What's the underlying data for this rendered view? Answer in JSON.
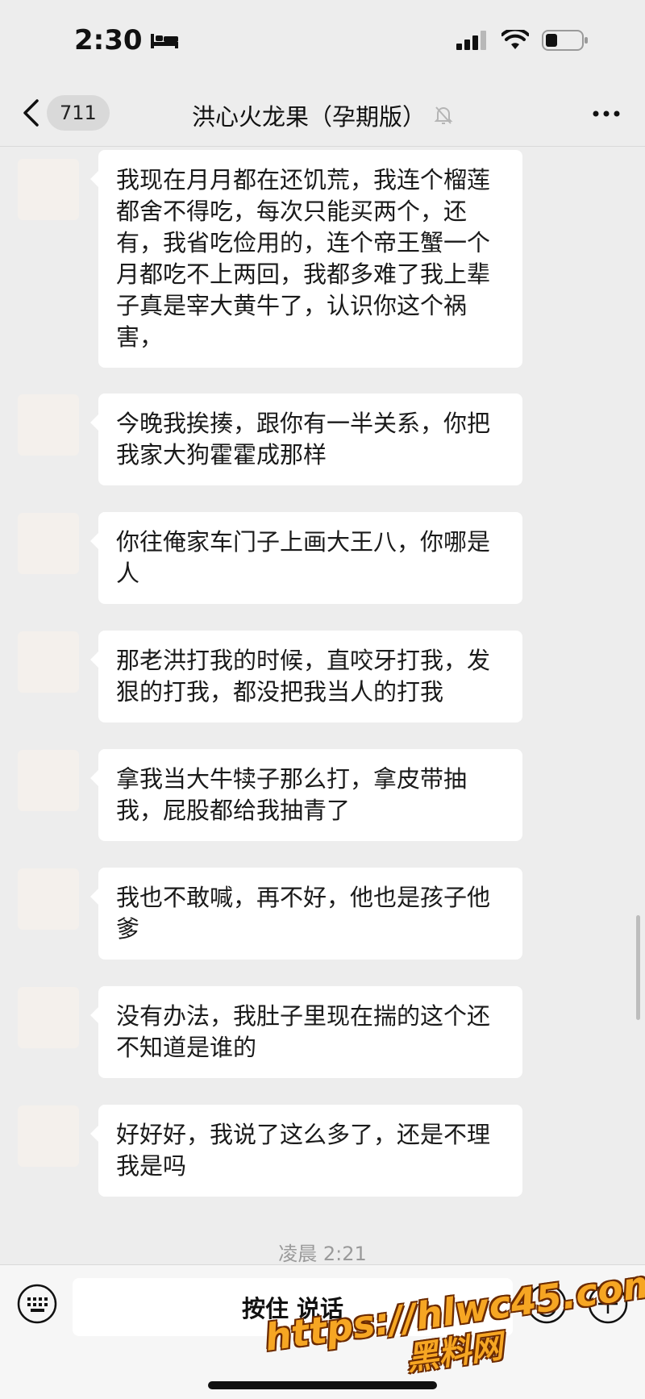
{
  "status_bar": {
    "time": "2:30"
  },
  "nav": {
    "back_count": "711",
    "title": "洪心火龙果（孕期版）"
  },
  "messages": [
    {
      "text": "我现在月月都在还饥荒，我连个榴莲都舍不得吃，每次只能买两个，还有，我省吃俭用的，连个帝王蟹一个月都吃不上两回，我都多难了我上辈子真是宰大黄牛了，认识你这个祸害，",
      "sender": "other"
    },
    {
      "text": "今晚我挨揍，跟你有一半关系，你把我家大狗霍霍成那样",
      "sender": "other"
    },
    {
      "text": "你往俺家车门子上画大王八，你哪是人",
      "sender": "other"
    },
    {
      "text": "那老洪打我的时候，直咬牙打我，发狠的打我，都没把我当人的打我",
      "sender": "other"
    },
    {
      "text": "拿我当大牛犊子那么打，拿皮带抽我，屁股都给我抽青了",
      "sender": "other"
    },
    {
      "text": "我也不敢喊，再不好，他也是孩子他爹",
      "sender": "other"
    },
    {
      "text": "没有办法，我肚子里现在揣的这个还不知道是谁的",
      "sender": "other"
    },
    {
      "text": "好好好，我说了这么多了，还是不理我是吗",
      "sender": "other"
    }
  ],
  "timestamp": "凌晨 2:21",
  "input_bar": {
    "voice_label": "按住 说话"
  },
  "watermark": {
    "url": "https://hlwc45.com",
    "name": "黑料网"
  },
  "colors": {
    "background": "#ededed",
    "bubble": "#ffffff",
    "watermark": "#f6a623"
  },
  "icons": [
    "back-chevron-icon",
    "bell-muted-icon",
    "more-icon",
    "keyboard-icon",
    "emoji-icon",
    "plus-icon",
    "signal-icon",
    "wifi-icon",
    "battery-icon",
    "bed-icon"
  ]
}
